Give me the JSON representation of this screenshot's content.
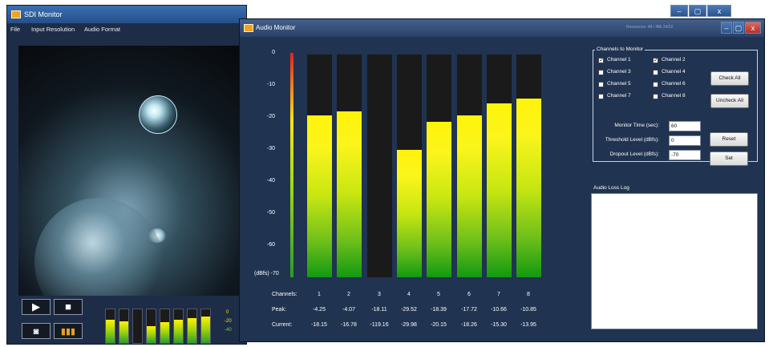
{
  "main_window": {
    "title": "SDI Monitor",
    "menu": [
      "File",
      "Input Resolution",
      "Audio Format"
    ],
    "buttons": {
      "minimize": "–",
      "maximize": "▢",
      "close": "x"
    },
    "mini_scale": [
      "0",
      "-20",
      "-40"
    ],
    "mini_levels": [
      0.7,
      0.65,
      0.0,
      0.5,
      0.62,
      0.7,
      0.75,
      0.78
    ]
  },
  "audio_window": {
    "title": "Audio Monitor",
    "title_right": "Resources: 48 / 48k 24/32",
    "scale": {
      "ticks": [
        "0",
        "-10",
        "-20",
        "-30",
        "-40",
        "-50",
        "-60"
      ],
      "bottom": "(dBfs) -70"
    },
    "rows": {
      "channels": "Channels:",
      "peak": "Peak:",
      "current": "Current:"
    },
    "meters": [
      {
        "channel": "1",
        "peak": "-4.25",
        "current": "-18.15",
        "level": 0.727
      },
      {
        "channel": "2",
        "peak": "-4.07",
        "current": "-16.78",
        "level": 0.744
      },
      {
        "channel": "3",
        "peak": "-18.11",
        "current": "-119.16",
        "level": 0.0
      },
      {
        "channel": "4",
        "peak": "-29.52",
        "current": "-29.98",
        "level": 0.571
      },
      {
        "channel": "5",
        "peak": "-18.39",
        "current": "-20.15",
        "level": 0.698
      },
      {
        "channel": "6",
        "peak": "-17.72",
        "current": "-18.26",
        "level": 0.727
      },
      {
        "channel": "7",
        "peak": "-10.66",
        "current": "-15.30",
        "level": 0.781
      },
      {
        "channel": "8",
        "peak": "-10.85",
        "current": "-13.95",
        "level": 0.802
      }
    ],
    "channels_group": {
      "title": "Channels to Monitor",
      "items": [
        {
          "label": "Channel 1",
          "checked": true
        },
        {
          "label": "Channel 2",
          "checked": true
        },
        {
          "label": "Channel 3",
          "checked": false
        },
        {
          "label": "Channel 4",
          "checked": false
        },
        {
          "label": "Channel 5",
          "checked": false
        },
        {
          "label": "Channel 6",
          "checked": false
        },
        {
          "label": "Channel 7",
          "checked": false
        },
        {
          "label": "Channel 8",
          "checked": false
        }
      ],
      "check_all": "Check All",
      "uncheck_all": "Uncheck All"
    },
    "settings": {
      "monitor_time_label": "Monitor Time (sec):",
      "monitor_time_value": "60",
      "threshold_label": "Threshold Level (dBfs):",
      "threshold_value": "0",
      "dropout_label": "Dropout Level (dBfs):",
      "dropout_value": "-70",
      "reset": "Reset",
      "set": "Set"
    },
    "log_label": "Audio Loss Log"
  },
  "colors": {
    "window_bg": "#203351",
    "meter_top": "#fff30a",
    "meter_bottom": "#119a11"
  }
}
